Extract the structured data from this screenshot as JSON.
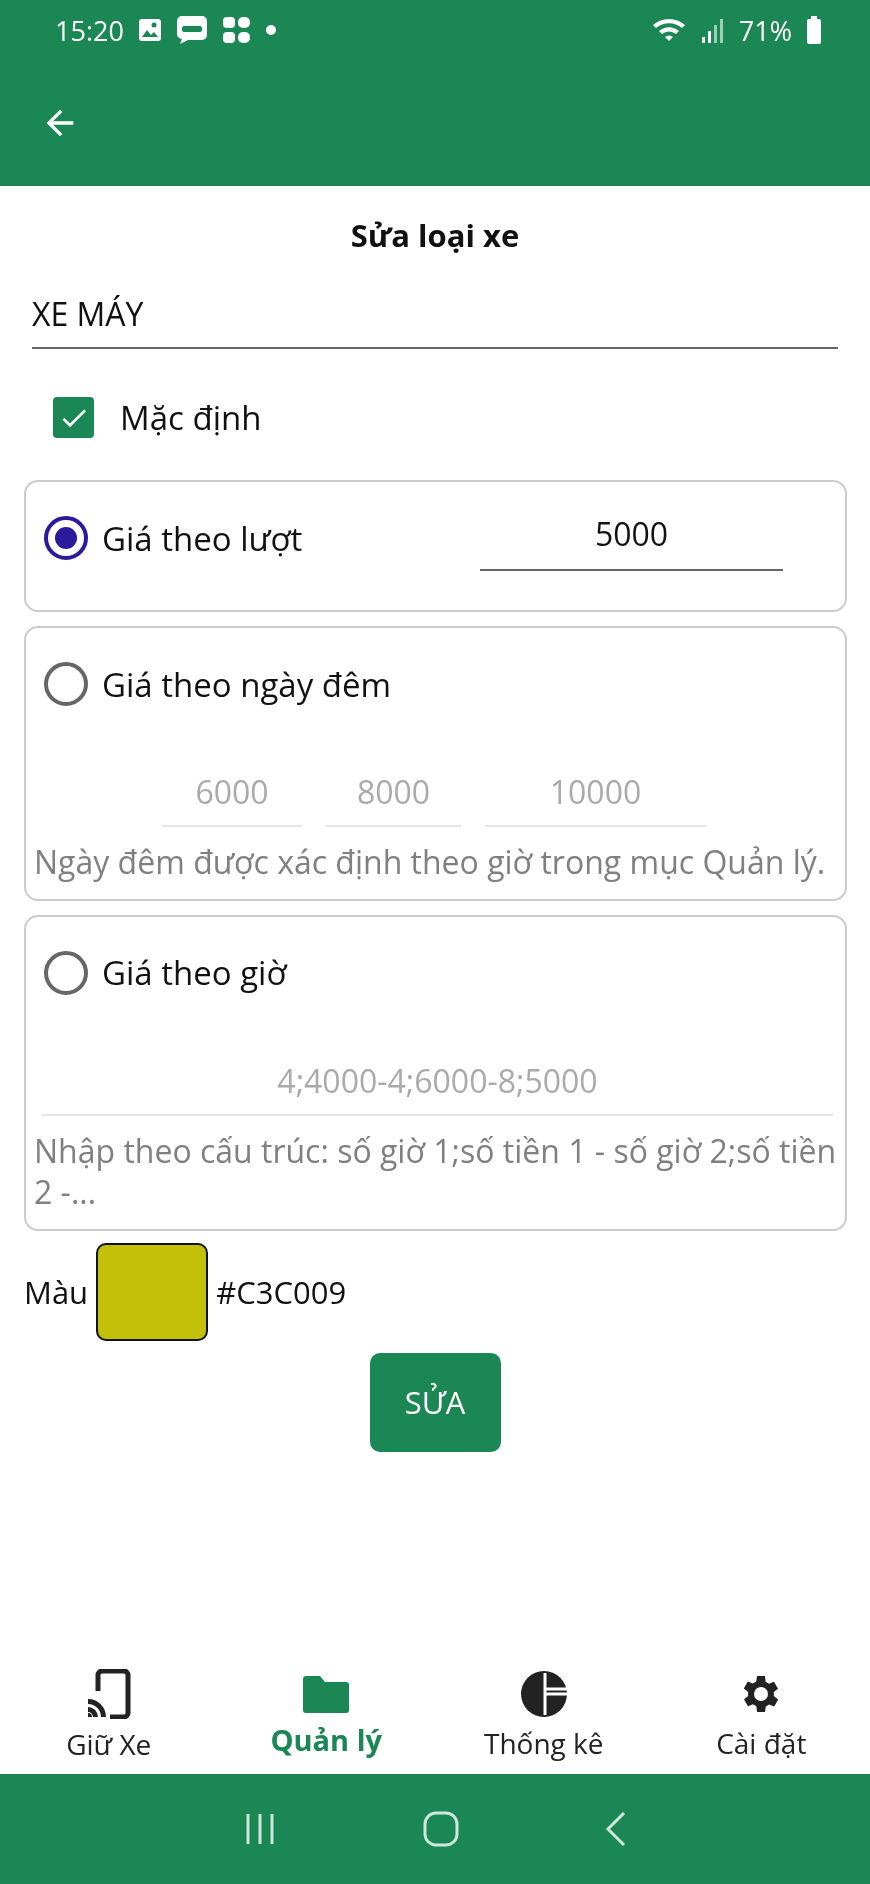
{
  "status_bar": {
    "time": "15:20",
    "battery": "71%"
  },
  "title": "Sửa loại xe",
  "name_field": {
    "value": "XE MÁY"
  },
  "default_checkbox": {
    "label": "Mặc định",
    "checked": true
  },
  "pricing_options": [
    {
      "kind": "single",
      "label": "Giá theo lượt",
      "selected": true,
      "fields": [
        "5000"
      ]
    },
    {
      "kind": "multi",
      "label": "Giá theo ngày đêm",
      "selected": false,
      "fields": [
        "6000",
        "8000",
        "10000"
      ],
      "note": "Ngày đêm được xác định theo giờ trong mục Quản lý."
    },
    {
      "kind": "wide",
      "label": "Giá theo giờ",
      "selected": false,
      "fields": [
        "4;4000-4;6000-8;5000"
      ],
      "note": "Nhập theo cấu trúc: số giờ 1;số tiền 1 - số giờ 2;số tiền 2 -..."
    }
  ],
  "color_picker": {
    "label": "Màu",
    "color": "#c3c009",
    "hex": "#C3C009"
  },
  "submit_button": "SỬA",
  "bottom_nav": [
    {
      "label": "Giữ Xe",
      "selected": false
    },
    {
      "label": "Quản lý",
      "selected": true
    },
    {
      "label": "Thống kê",
      "selected": false
    },
    {
      "label": "Cài đặt",
      "selected": false
    }
  ]
}
